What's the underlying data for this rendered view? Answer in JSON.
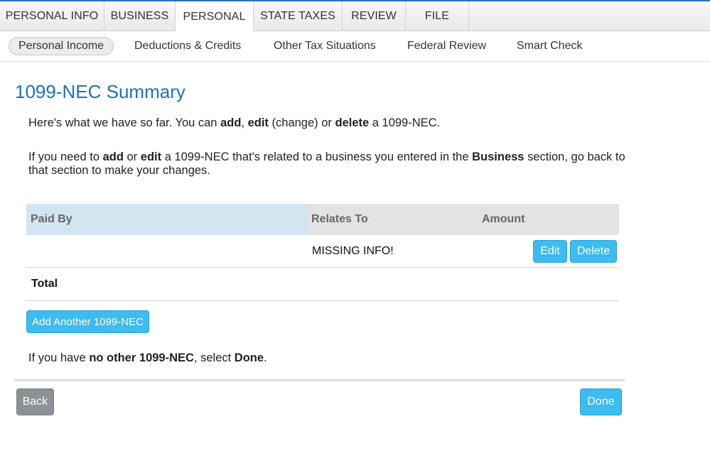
{
  "top_tabs": [
    {
      "label": "PERSONAL INFO"
    },
    {
      "label": "BUSINESS"
    },
    {
      "label": "PERSONAL"
    },
    {
      "label": "STATE TAXES"
    },
    {
      "label": "REVIEW"
    },
    {
      "label": "FILE"
    }
  ],
  "active_top_tab": "PERSONAL",
  "sub_nav": [
    {
      "label": "Personal Income"
    },
    {
      "label": "Deductions & Credits"
    },
    {
      "label": "Other Tax Situations"
    },
    {
      "label": "Federal Review"
    },
    {
      "label": "Smart Check"
    }
  ],
  "active_sub_nav": "Personal Income",
  "page": {
    "title": "1099-NEC Summary",
    "intro": {
      "t1": "Here's what we have so far. You can ",
      "b1": "add",
      "t2": ", ",
      "b2": "edit",
      "t3": " (change) or ",
      "b3": "delete",
      "t4": " a 1099-NEC."
    },
    "business_note": {
      "t1": "If you need to ",
      "b1": "add",
      "t2": " or ",
      "b2": "edit",
      "t3": " a 1099-NEC that's related to a business you entered in the ",
      "b3": "Business",
      "t4": " section, go back to that section to make your changes."
    },
    "done_note": {
      "t1": "If you have ",
      "b1": "no other 1099-NEC",
      "t2": ", select ",
      "b2": "Done",
      "t3": "."
    }
  },
  "table": {
    "headers": {
      "paid_by": "Paid By",
      "relates_to": "Relates To",
      "amount": "Amount"
    },
    "rows": [
      {
        "paid_by": "",
        "relates_to": "MISSING INFO!",
        "amount": "",
        "edit_label": "Edit",
        "delete_label": "Delete"
      }
    ],
    "total_label": "Total"
  },
  "buttons": {
    "add_another": "Add Another 1099-NEC",
    "back": "Back",
    "done": "Done"
  },
  "colors": {
    "accent_blue": "#1d72b8",
    "button_blue": "#3cbcf0",
    "back_gray": "#8c9196",
    "header_blue": "#d2e6f2"
  }
}
